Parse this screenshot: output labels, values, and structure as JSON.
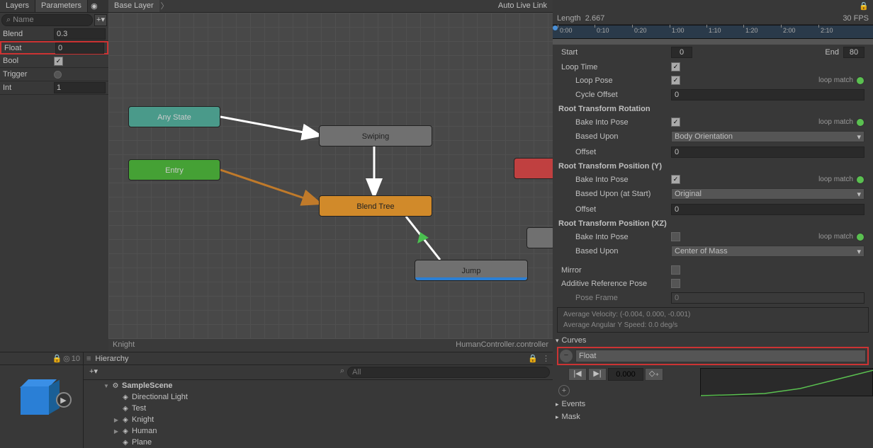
{
  "tabs": {
    "layers": "Layers",
    "parameters": "Parameters"
  },
  "search": {
    "placeholder": "Name"
  },
  "params": [
    {
      "name": "Blend",
      "type": "float",
      "value": "0.3"
    },
    {
      "name": "Float",
      "type": "float",
      "value": "0",
      "highlight": true
    },
    {
      "name": "Bool",
      "type": "bool",
      "value": true
    },
    {
      "name": "Trigger",
      "type": "trigger",
      "value": false
    },
    {
      "name": "Int",
      "type": "int",
      "value": "1"
    }
  ],
  "breadcrumb": "Base Layer",
  "auto_live": "Auto Live Link",
  "nodes": {
    "any": "Any State",
    "entry": "Entry",
    "swiping": "Swiping",
    "blend": "Blend Tree",
    "jump": "Jump"
  },
  "status": {
    "left": "Knight",
    "right": "HumanController.controller"
  },
  "inspector": {
    "length_label": "Length",
    "length_value": "2.667",
    "fps": "30 FPS",
    "ticks": [
      "0:00",
      "0:10",
      "0:20",
      "1:00",
      "1:10",
      "1:20",
      "2:00",
      "2:10"
    ],
    "start_label": "Start",
    "start_value": "0",
    "end_label": "End",
    "end_value": "80",
    "loop_time": "Loop Time",
    "loop_pose": "Loop Pose",
    "cycle_offset": "Cycle Offset",
    "cycle_offset_value": "0",
    "loop_match": "loop match",
    "root_rot": "Root Transform Rotation",
    "bake_pose": "Bake Into Pose",
    "based_upon": "Based Upon",
    "based_upon_rot": "Body Orientation",
    "offset": "Offset",
    "offset_rot_value": "0",
    "root_pos_y": "Root Transform Position (Y)",
    "based_upon_start": "Based Upon (at Start)",
    "based_upon_y": "Original",
    "offset_y_value": "0",
    "root_pos_xz": "Root Transform Position (XZ)",
    "based_upon_xz": "Center of Mass",
    "mirror": "Mirror",
    "additive_ref": "Additive Reference Pose",
    "pose_frame": "Pose Frame",
    "pose_frame_value": "0",
    "avg_velocity": "Average Velocity: (-0.004, 0.000, -0.001)",
    "avg_angular": "Average Angular Y Speed: 0.0 deg/s",
    "curves": "Curves",
    "curves_item": "Float",
    "player_time": "0.000",
    "events": "Events",
    "mask": "Mask"
  },
  "hierarchy": {
    "title": "Hierarchy",
    "search_placeholder": "All",
    "scene": "SampleScene",
    "items": [
      "Directional Light",
      "Test",
      "Knight",
      "Human",
      "Plane"
    ]
  },
  "bottom_info": "10",
  "chart_data": {
    "type": "line",
    "title": "Float animation curve",
    "x": [
      0,
      0.5,
      1.0,
      1.5,
      2.0,
      2.667
    ],
    "values": [
      0.0,
      0.02,
      0.08,
      0.25,
      0.6,
      1.0
    ],
    "xlim": [
      0,
      2.667
    ],
    "ylim": [
      0,
      1
    ]
  }
}
